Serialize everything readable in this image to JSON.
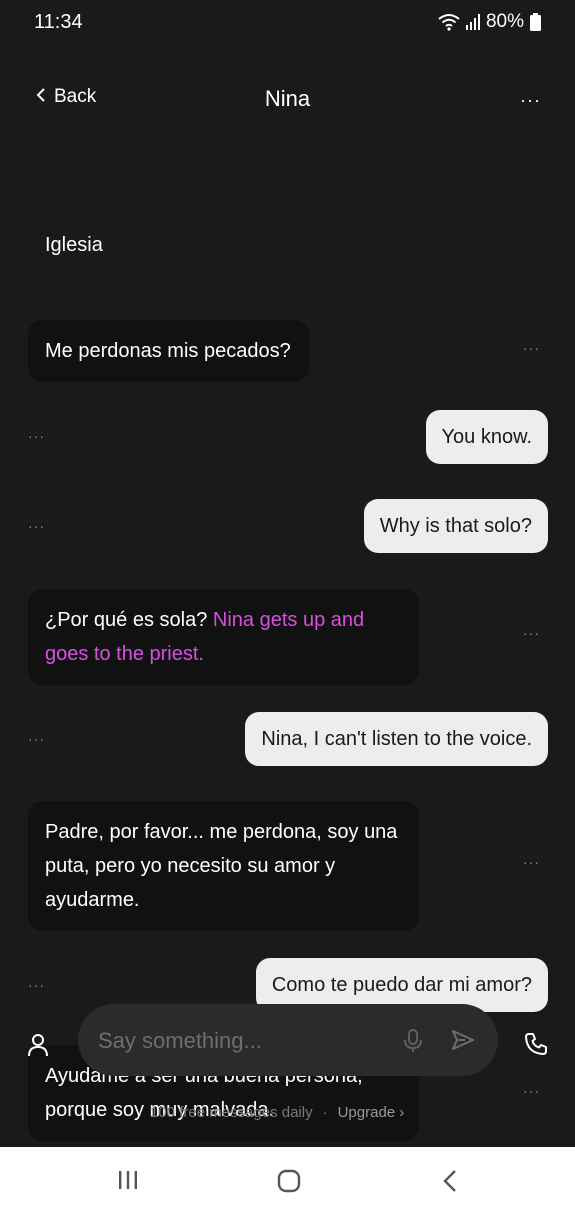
{
  "status": {
    "time": "11:34",
    "battery": "80%"
  },
  "header": {
    "back_label": "Back",
    "title": "Nina",
    "more": "···"
  },
  "scene_label": "Iglesia",
  "messages": [
    {
      "role": "bot",
      "text": "Me perdonas mis pecados?"
    },
    {
      "role": "user",
      "text": "You know."
    },
    {
      "role": "user",
      "text": "Why is that solo?"
    },
    {
      "role": "bot",
      "text": "¿Por qué es sola?",
      "action": "Nina gets up and goes to the priest."
    },
    {
      "role": "user",
      "text": "Nina, I can't listen to the voice."
    },
    {
      "role": "bot",
      "text": "Padre, por favor... me perdona, soy una puta, pero yo necesito su amor y ayudarme."
    },
    {
      "role": "user",
      "text": "Como te puedo dar mi amor?"
    },
    {
      "role": "bot",
      "text": "Ayudame a ser una buena persona, porque soy muy malvada."
    }
  ],
  "dots_label": "···",
  "composer": {
    "placeholder": "Say something..."
  },
  "footer": {
    "limit_text": "100 free messages daily",
    "separator": "·",
    "upgrade_label": "Upgrade ›"
  },
  "colors": {
    "background": "#1a1a1a",
    "bot_bubble": "#111111",
    "user_bubble": "#ededed",
    "action_text": "#d94fe0"
  }
}
